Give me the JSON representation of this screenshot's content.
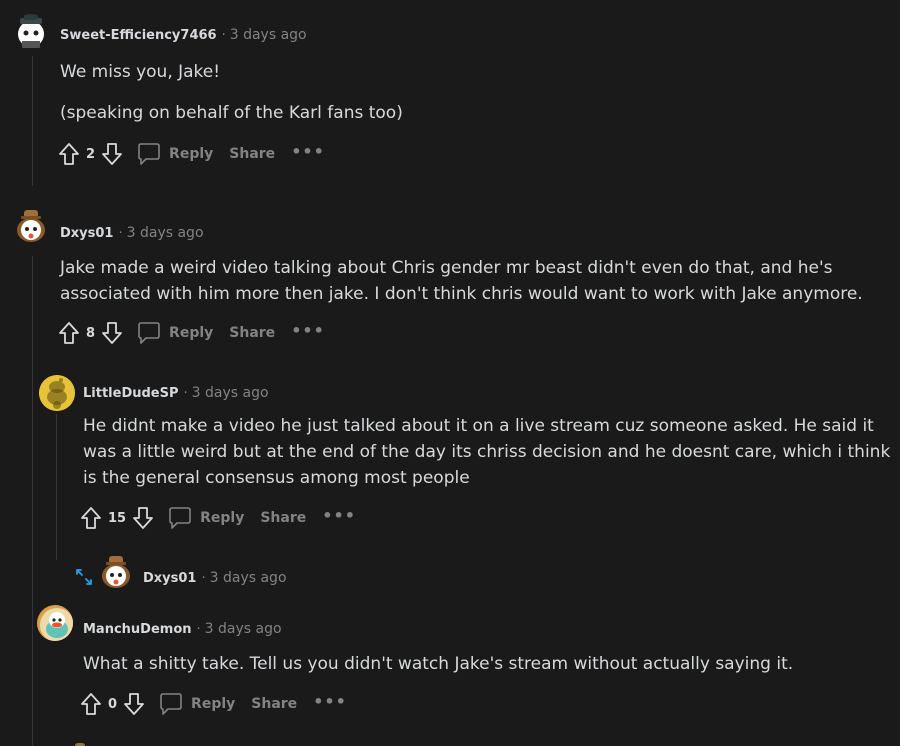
{
  "comments": [
    {
      "username": "Sweet-Efficiency7466",
      "time": "3 days ago",
      "lines": [
        "We miss you, Jake!",
        "(speaking on behalf of the Karl fans too)"
      ],
      "votes": "2",
      "reply_label": "Reply",
      "share_label": "Share",
      "more_label": "•••"
    },
    {
      "username": "Dxys01",
      "time": "3 days ago",
      "lines": [
        "Jake made a weird video talking about Chris gender mr beast didn't even do that, and he's",
        "associated with him more then jake. I don't think chris would want to work with Jake anymore."
      ],
      "votes": "8",
      "reply_label": "Reply",
      "share_label": "Share",
      "more_label": "•••"
    },
    {
      "username": "LittleDudeSP",
      "time": "3 days ago",
      "lines": [
        "He didnt make a video he just talked about it on a live stream cuz someone asked. He said it",
        "was a little weird but at the end of the day its chriss decision and he doesnt care, which i think",
        "is the general consensus among most people"
      ],
      "votes": "15",
      "reply_label": "Reply",
      "share_label": "Share",
      "more_label": "•••"
    },
    {
      "username": "Dxys01",
      "time": "3 days ago",
      "collapsed": true
    },
    {
      "username": "ManchuDemon",
      "time": "3 days ago",
      "lines": [
        "What a shitty take. Tell us you didn't watch Jake's stream without actually saying it."
      ],
      "votes": "0",
      "reply_label": "Reply",
      "share_label": "Share",
      "more_label": "•••"
    }
  ],
  "colors": {
    "background": "#1a1a1b",
    "text": "#d7dadc",
    "muted": "#818384",
    "thread_line": "#343536",
    "expand_icon": "#24a0ed"
  }
}
